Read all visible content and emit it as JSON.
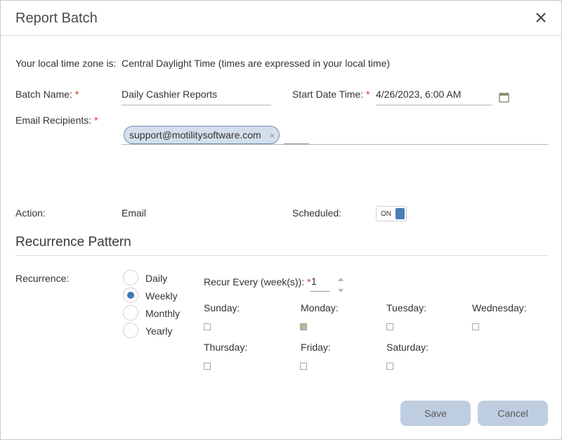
{
  "dialog": {
    "title": "Report Batch",
    "close_icon": "close-icon"
  },
  "timezone": {
    "label": "Your local time zone is:",
    "value": "Central Daylight Time (times are expressed in your local time)"
  },
  "batch_name": {
    "label": "Batch Name:",
    "required_mark": "*",
    "value": "Daily Cashier Reports"
  },
  "start_date_time": {
    "label": "Start Date Time:",
    "required_mark": "*",
    "value": "4/26/2023, 6:00 AM",
    "icon": "calendar-icon"
  },
  "email_recipients": {
    "label": "Email Recipients:",
    "required_mark": "*",
    "chips": [
      {
        "text": "support@motilitysoftware.com",
        "remove": "×"
      }
    ]
  },
  "action": {
    "label": "Action:",
    "value": "Email"
  },
  "scheduled": {
    "label": "Scheduled:",
    "toggle_text": "ON",
    "on": true
  },
  "recurrence_pattern": {
    "title": "Recurrence Pattern",
    "label": "Recurrence:",
    "options": [
      {
        "label": "Daily",
        "selected": false
      },
      {
        "label": "Weekly",
        "selected": true
      },
      {
        "label": "Monthly",
        "selected": false
      },
      {
        "label": "Yearly",
        "selected": false
      }
    ],
    "recur_every": {
      "label": "Recur Every (week(s)):",
      "required_mark": "*",
      "value": "1"
    },
    "days": [
      {
        "label": "Sunday:",
        "checked": false
      },
      {
        "label": "Monday:",
        "checked": true
      },
      {
        "label": "Tuesday:",
        "checked": false
      },
      {
        "label": "Wednesday:",
        "checked": false
      },
      {
        "label": "Thursday:",
        "checked": false
      },
      {
        "label": "Friday:",
        "checked": false
      },
      {
        "label": "Saturday:",
        "checked": false
      }
    ]
  },
  "buttons": {
    "save": "Save",
    "cancel": "Cancel"
  },
  "colors": {
    "accent": "#3f78b3",
    "button_bg": "#bfcde0",
    "chip_bg": "#d4dfec",
    "required": "#d9342b",
    "checked_box": "#b5b89d"
  }
}
